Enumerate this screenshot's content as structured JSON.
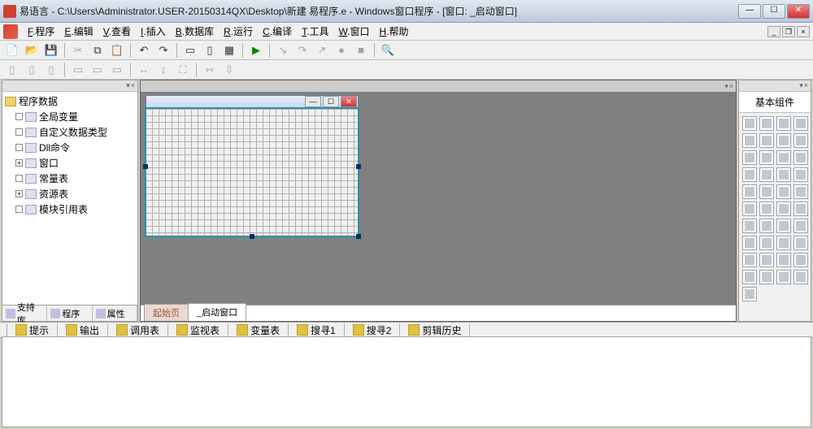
{
  "title": "易语言 - C:\\Users\\Administrator.USER-20150314QX\\Desktop\\新建 易程序.e - Windows窗口程序 - [窗口: _启动窗口]",
  "menu": [
    {
      "hk": "F",
      "label": "程序"
    },
    {
      "hk": "E",
      "label": "编辑"
    },
    {
      "hk": "V",
      "label": "查看"
    },
    {
      "hk": "I",
      "label": "插入"
    },
    {
      "hk": "B",
      "label": "数据库"
    },
    {
      "hk": "R",
      "label": "运行"
    },
    {
      "hk": "C",
      "label": "编译"
    },
    {
      "hk": "T",
      "label": "工具"
    },
    {
      "hk": "W",
      "label": "窗口"
    },
    {
      "hk": "H",
      "label": "帮助"
    }
  ],
  "tree": {
    "root": "程序数据",
    "items": [
      {
        "exp": " ",
        "label": "全局变量",
        "indent": 0
      },
      {
        "exp": " ",
        "label": "自定义数据类型",
        "indent": 0
      },
      {
        "exp": " ",
        "label": "Dll命令",
        "indent": 0
      },
      {
        "exp": "+",
        "label": "窗口",
        "indent": 0
      },
      {
        "exp": " ",
        "label": "常量表",
        "indent": 0
      },
      {
        "exp": "+",
        "label": "资源表",
        "indent": 0
      },
      {
        "exp": " ",
        "label": "模块引用表",
        "indent": 0
      }
    ]
  },
  "left_tabs": [
    {
      "label": "支持库"
    },
    {
      "label": "程序"
    },
    {
      "label": "属性"
    }
  ],
  "center_tabs": [
    {
      "label": "起始页",
      "active": false
    },
    {
      "label": "_启动窗口",
      "active": true
    }
  ],
  "right_header": "基本组件",
  "bottom_tabs": [
    {
      "label": "提示"
    },
    {
      "label": "输出"
    },
    {
      "label": "调用表"
    },
    {
      "label": "监视表"
    },
    {
      "label": "变量表"
    },
    {
      "label": "搜寻1"
    },
    {
      "label": "搜寻2"
    },
    {
      "label": "剪辑历史"
    }
  ],
  "winbtns": {
    "min": "—",
    "max": "☐",
    "close": "✕"
  },
  "mdi": {
    "min": "_",
    "restore": "❐",
    "close": "×"
  },
  "form_btns": {
    "min": "—",
    "max": "☐",
    "close": "✕"
  }
}
